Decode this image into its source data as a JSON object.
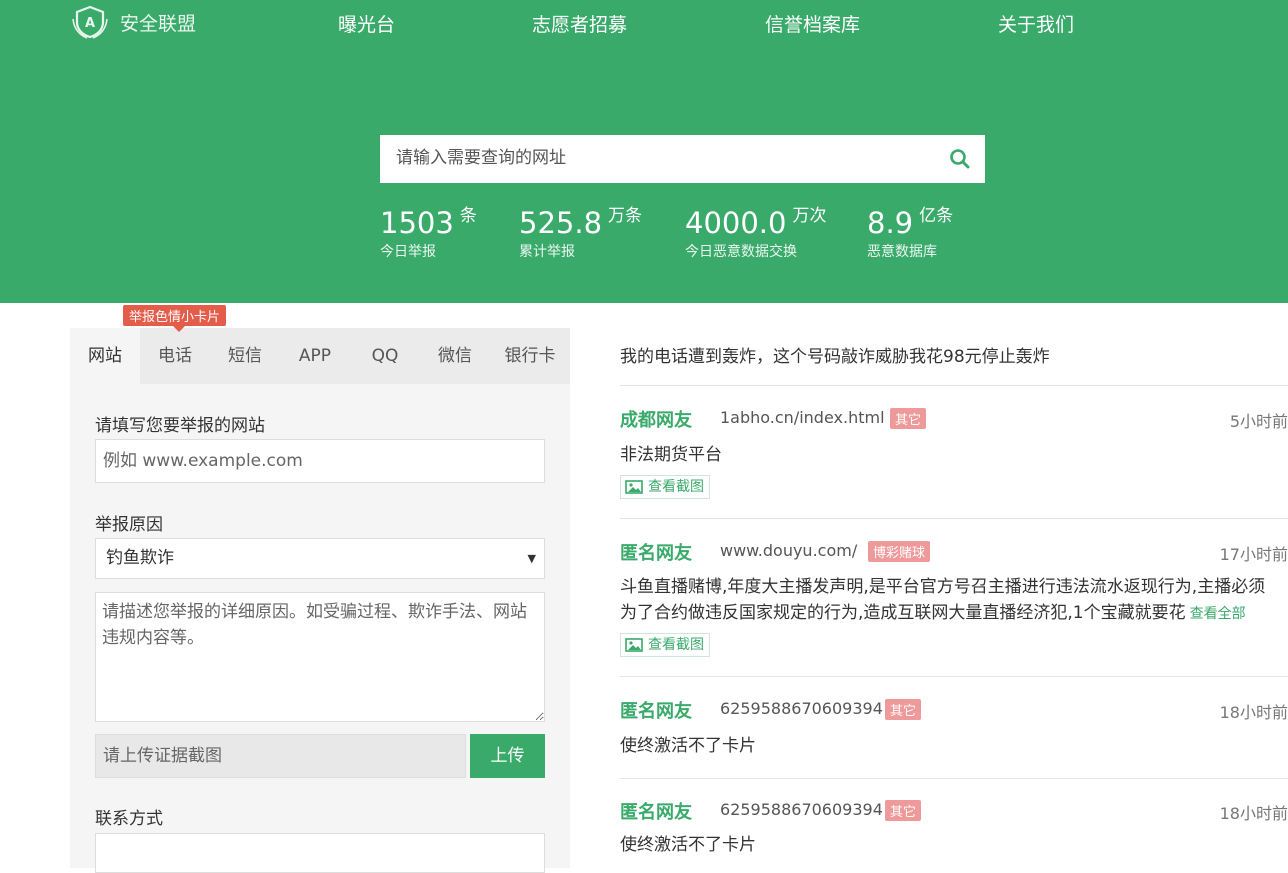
{
  "brand": {
    "name": "安全联盟"
  },
  "nav": [
    {
      "label": "曝光台"
    },
    {
      "label": "志愿者招募"
    },
    {
      "label": "信誉档案库"
    },
    {
      "label": "关于我们"
    }
  ],
  "search": {
    "placeholder": "请输入需要查询的网址"
  },
  "stats": [
    {
      "value": "1503",
      "unit": "条",
      "label": "今日举报"
    },
    {
      "value": "525.8",
      "unit": "万条",
      "label": "累计举报"
    },
    {
      "value": "4000.0",
      "unit": "万次",
      "label": "今日恶意数据交换"
    },
    {
      "value": "8.9",
      "unit": "亿条",
      "label": "恶意数据库"
    }
  ],
  "report": {
    "badge": "举报色情小卡片",
    "tabs": [
      "网站",
      "电话",
      "短信",
      "APP",
      "QQ",
      "微信",
      "银行卡"
    ],
    "site_label": "请填写您要举报的网站",
    "site_placeholder": "例如 www.example.com",
    "reason_label": "举报原因",
    "reason_selected": "钓鱼欺诈",
    "detail_placeholder": "请描述您举报的详细原因。如受骗过程、欺诈手法、网站违规内容等。",
    "upload_placeholder": "请上传证据截图",
    "upload_button": "上传",
    "contact_label": "联系方式"
  },
  "feed": {
    "headline": "我的电话遭到轰炸，这个号码敲诈威胁我花98元停止轰炸",
    "screenshot_label": "查看截图",
    "more_label": "查看全部",
    "items": [
      {
        "author": "成都网友",
        "target": "1abho.cn/index.html",
        "tag": "其它",
        "time": "5小时前",
        "desc": "非法期货平台"
      },
      {
        "author": "匿名网友",
        "target": "www.douyu.com/",
        "tag": "博彩赌球",
        "time": "17小时前",
        "desc1": "斗鱼直播赌博,年度大主播发声明,是平台官方号召主播进行违法流水返现行为,主播必须",
        "desc2": "为了合约做违反国家规定的行为,造成互联网大量直播经济犯,1个宝藏就要花"
      },
      {
        "author": "匿名网友",
        "target": "6259588670609394",
        "tag": "其它",
        "time": "18小时前",
        "desc": "使终激活不了卡片"
      },
      {
        "author": "匿名网友",
        "target": "6259588670609394",
        "tag": "其它",
        "time": "18小时前",
        "desc": "使终激活不了卡片"
      }
    ]
  }
}
